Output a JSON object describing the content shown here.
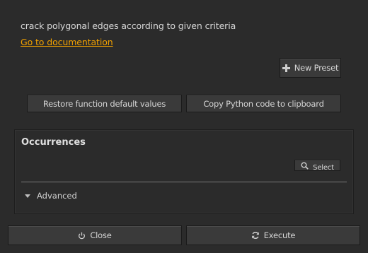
{
  "description": "crack polygonal edges according to given criteria",
  "doc_link": "Go to documentation",
  "presets": {
    "new_preset_label": "New Preset",
    "new_preset_icon": "plus-icon"
  },
  "actions": {
    "restore_label": "Restore function default values",
    "copy_python_label": "Copy Python code to clipboard"
  },
  "occurrences": {
    "title": "Occurrences",
    "select_label": "Select",
    "select_icon": "search-icon",
    "advanced_label": "Advanced",
    "advanced_icon": "triangle-down-icon"
  },
  "footer": {
    "close_label": "Close",
    "close_icon": "power-icon",
    "execute_label": "Execute",
    "execute_icon": "refresh-icon"
  }
}
